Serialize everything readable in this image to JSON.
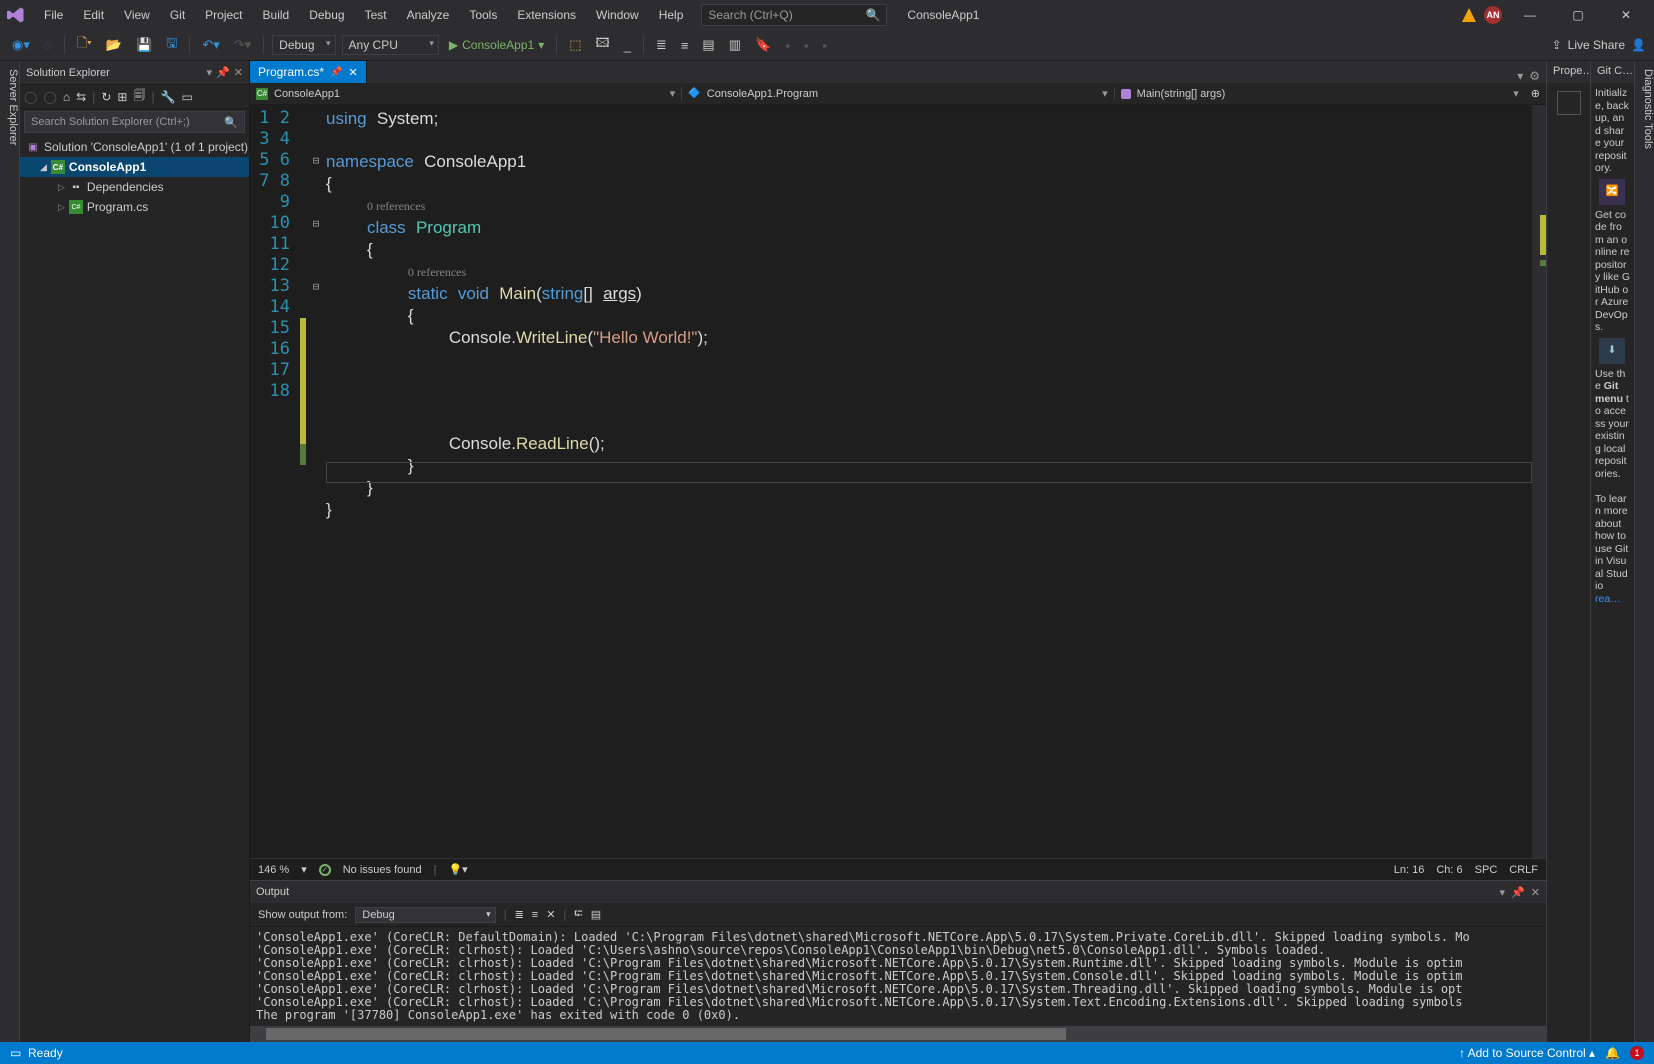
{
  "menubar": {
    "items": [
      "File",
      "Edit",
      "View",
      "Git",
      "Project",
      "Build",
      "Debug",
      "Test",
      "Analyze",
      "Tools",
      "Extensions",
      "Window",
      "Help"
    ],
    "search_placeholder": "Search (Ctrl+Q)",
    "app_title": "ConsoleApp1",
    "avatar": "AN"
  },
  "toolbar": {
    "config": "Debug",
    "platform": "Any CPU",
    "run_target": "ConsoleApp1",
    "live_share": "Live Share"
  },
  "left_rail": "Server Explorer",
  "right_rail": "Diagnostic Tools",
  "solution_explorer": {
    "title": "Solution Explorer",
    "search_placeholder": "Search Solution Explorer (Ctrl+;)",
    "root": "Solution 'ConsoleApp1' (1 of 1 project)",
    "project": "ConsoleApp1",
    "deps": "Dependencies",
    "program": "Program.cs"
  },
  "tab": {
    "label": "Program.cs*"
  },
  "nav": {
    "a": "ConsoleApp1",
    "b": "ConsoleApp1.Program",
    "c": "Main(string[] args)"
  },
  "codelens": {
    "a": "0 references",
    "b": "0 references"
  },
  "code_tokens": {
    "using": "using",
    "system": "System",
    "semi": ";",
    "namespace": "namespace",
    "ns": "ConsoleApp1",
    "ob": "{",
    "cb": "}",
    "class": "class",
    "prog": "Program",
    "static": "static",
    "void": "void",
    "main": "Main",
    "string": "string",
    "args": "args",
    "brk": "[]",
    "op": "(",
    "cp": ")",
    "console": "Console",
    "dot": ".",
    "writeline": "WriteLine",
    "hello": "\"Hello World!\"",
    "readline": "ReadLine",
    "unit": "()"
  },
  "editor_status": {
    "zoom": "146 %",
    "issues": "No issues found",
    "ln": "Ln: 16",
    "ch": "Ch: 6",
    "spc": "SPC",
    "eol": "CRLF"
  },
  "output": {
    "title": "Output",
    "from_lbl": "Show output from:",
    "from_val": "Debug",
    "text": "'ConsoleApp1.exe' (CoreCLR: DefaultDomain): Loaded 'C:\\Program Files\\dotnet\\shared\\Microsoft.NETCore.App\\5.0.17\\System.Private.CoreLib.dll'. Skipped loading symbols. Mo\n'ConsoleApp1.exe' (CoreCLR: clrhost): Loaded 'C:\\Users\\ashno\\source\\repos\\ConsoleApp1\\ConsoleApp1\\bin\\Debug\\net5.0\\ConsoleApp1.dll'. Symbols loaded.\n'ConsoleApp1.exe' (CoreCLR: clrhost): Loaded 'C:\\Program Files\\dotnet\\shared\\Microsoft.NETCore.App\\5.0.17\\System.Runtime.dll'. Skipped loading symbols. Module is optim\n'ConsoleApp1.exe' (CoreCLR: clrhost): Loaded 'C:\\Program Files\\dotnet\\shared\\Microsoft.NETCore.App\\5.0.17\\System.Console.dll'. Skipped loading symbols. Module is optim\n'ConsoleApp1.exe' (CoreCLR: clrhost): Loaded 'C:\\Program Files\\dotnet\\shared\\Microsoft.NETCore.App\\5.0.17\\System.Threading.dll'. Skipped loading symbols. Module is opt\n'ConsoleApp1.exe' (CoreCLR: clrhost): Loaded 'C:\\Program Files\\dotnet\\shared\\Microsoft.NETCore.App\\5.0.17\\System.Text.Encoding.Extensions.dll'. Skipped loading symbols\nThe program '[37780] ConsoleApp1.exe' has exited with code 0 (0x0)."
  },
  "right": {
    "prop_tab": "Prope…",
    "git_tab": "Git C…",
    "p1": "Initialize, back up, and share your repository.",
    "p2": "Get code from an online repository like GitHub or Azure DevOps.",
    "p3a": "Use the ",
    "git_word": "Git menu",
    "p3b": " to access your existing local repositories.",
    "p4": "To learn more about how to use Git in Visual Studio",
    "rea": "rea…"
  },
  "status": {
    "ready": "Ready",
    "src": "Add to Source Control",
    "bell": "1"
  }
}
